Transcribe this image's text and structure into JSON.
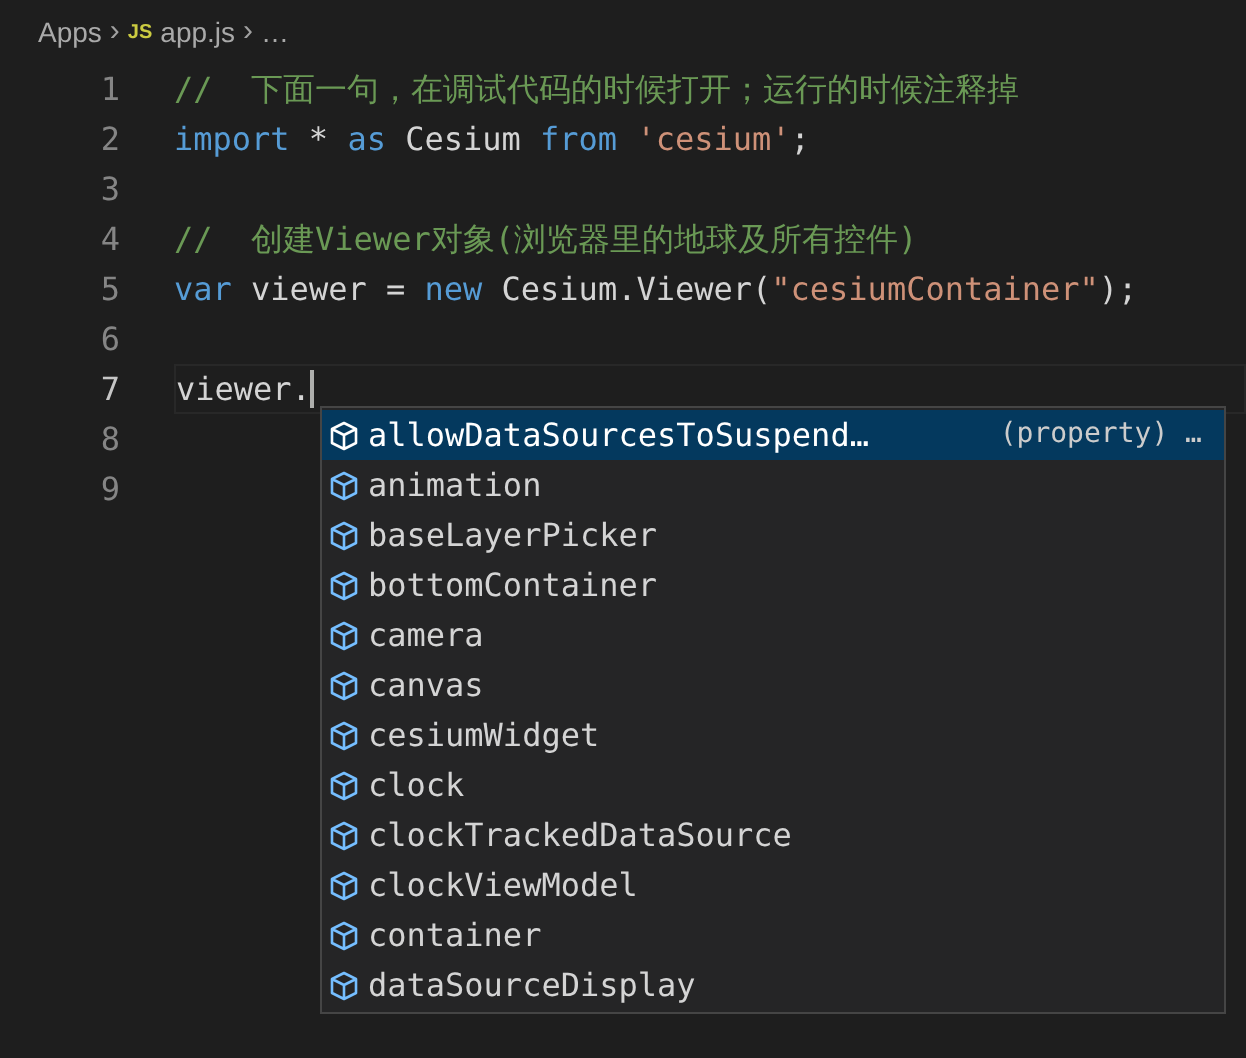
{
  "breadcrumb": {
    "items": [
      {
        "kind": "folder",
        "label": "Apps"
      },
      {
        "kind": "js-file",
        "separator": "›",
        "badge": "JS",
        "label": "app.js"
      },
      {
        "kind": "more",
        "separator": "›",
        "label": "…"
      }
    ]
  },
  "editor": {
    "lines": [
      {
        "number": "1",
        "current": false,
        "tokens": [
          {
            "kind": "comment",
            "text": "//  下面一句，在调试代码的时候打开；运行的时候注释掉"
          }
        ]
      },
      {
        "number": "2",
        "current": false,
        "tokens": [
          {
            "kind": "keyword",
            "text": "import"
          },
          {
            "kind": "plain",
            "text": " * "
          },
          {
            "kind": "keyword",
            "text": "as"
          },
          {
            "kind": "plain",
            "text": " Cesium "
          },
          {
            "kind": "keyword",
            "text": "from"
          },
          {
            "kind": "string",
            "text": " 'cesium'"
          },
          {
            "kind": "plain",
            "text": ";"
          }
        ]
      },
      {
        "number": "3",
        "current": false
      },
      {
        "number": "4",
        "current": false,
        "tokens": [
          {
            "kind": "comment",
            "text": "//  创建Viewer对象(浏览器里的地球及所有控件)"
          }
        ]
      },
      {
        "number": "5",
        "current": false,
        "tokens": [
          {
            "kind": "keyword",
            "text": "var"
          },
          {
            "kind": "plain",
            "text": " viewer = "
          },
          {
            "kind": "keyword",
            "text": "new"
          },
          {
            "kind": "plain",
            "text": " Cesium.Viewer("
          },
          {
            "kind": "string",
            "text": "\"cesiumContainer\""
          },
          {
            "kind": "plain",
            "text": ");"
          }
        ]
      },
      {
        "number": "6",
        "current": false
      },
      {
        "number": "7",
        "current": true,
        "tokens": [
          {
            "kind": "plain",
            "text": "viewer."
          }
        ]
      },
      {
        "number": "8",
        "current": false
      },
      {
        "number": "9",
        "current": false
      }
    ]
  },
  "suggestions": [
    {
      "label": "allowDataSourcesToSuspend…",
      "detail": "(property) …",
      "selected": true
    },
    {
      "label": "animation",
      "selected": false
    },
    {
      "label": "baseLayerPicker",
      "selected": false
    },
    {
      "label": "bottomContainer",
      "selected": false
    },
    {
      "label": "camera",
      "selected": false
    },
    {
      "label": "canvas",
      "selected": false
    },
    {
      "label": "cesiumWidget",
      "selected": false
    },
    {
      "label": "clock",
      "selected": false
    },
    {
      "label": "clockTrackedDataSource",
      "selected": false
    },
    {
      "label": "clockViewModel",
      "selected": false
    },
    {
      "label": "container",
      "selected": false
    },
    {
      "label": "dataSourceDisplay",
      "selected": false
    }
  ]
}
